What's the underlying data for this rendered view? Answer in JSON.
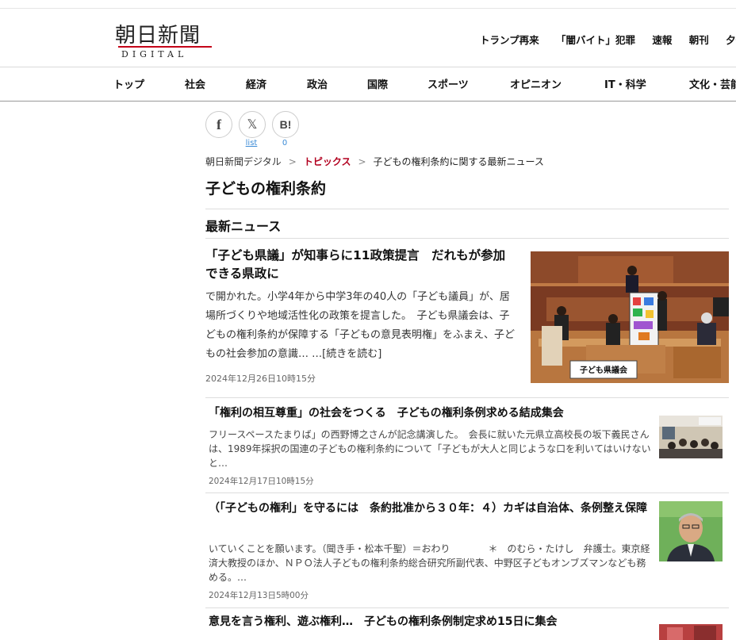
{
  "header": {
    "logo_main": "朝日新聞",
    "logo_sub": "DIGITAL",
    "top_links": [
      "トランプ再来",
      "「闇バイト」犯罪",
      "速報",
      "朝刊",
      "夕刊"
    ],
    "nav": [
      "トップ",
      "社会",
      "経済",
      "政治",
      "国際",
      "スポーツ",
      "オピニオン",
      "IT・科学",
      "文化・芸能"
    ]
  },
  "share": {
    "facebook_glyph": "f",
    "x_glyph": "𝕏",
    "hatena_glyph": "B!",
    "x_count": "list",
    "hatena_count": "0"
  },
  "breadcrumb": {
    "home": "朝日新聞デジタル",
    "sep": ">",
    "topics": "トピックス",
    "current": "子どもの権利条約に関する最新ニュース"
  },
  "page": {
    "title": "子どもの権利条約",
    "section": "最新ニュース"
  },
  "articles": [
    {
      "title": "「子ども県議」が知事らに11政策提言　だれもが参加できる県政に",
      "snippet": "で開かれた。小学4年から中学3年の40人の「子ども議員」が、居場所づくりや地域活性化の政策を提言した。　子ども県議会は、子どもの権利条約が保障する「子どもの意見表明権」をふまえ、子どもの社会参加の意識…",
      "more": "…[続きを読む]",
      "date": "2024年12月26日10時15分",
      "image_sign": "子ども県議会"
    },
    {
      "title": "「権利の相互尊重」の社会をつくる　子どもの権利条例求める結成集会",
      "snippet": "フリースペースたまりば」の西野博之さんが記念講演した。　会長に就いた元県立高校長の坂下義民さんは、1989年採択の国連の子どもの権利条約について「子どもが大人と同じような口を利いてはいけないと…",
      "date": "2024年12月17日10時15分"
    },
    {
      "title": "（「子どもの権利」を守るには　条約批准から３０年：４）カギは自治体、条例整え保障",
      "snippet": "いていくことを願います。（聞き手・松本千聖）＝おわり　　　　＊　のむら・たけし　弁護士。東京経済大教授のほか、ＮＰＯ法人子どもの権利条約総合研究所副代表、中野区子どもオンブズマンなども務める。…",
      "date": "2024年12月13日5時00分"
    },
    {
      "title": "意見を言う権利、遊ぶ権利…　子どもの権利条例制定求め15日に集会"
    }
  ]
}
